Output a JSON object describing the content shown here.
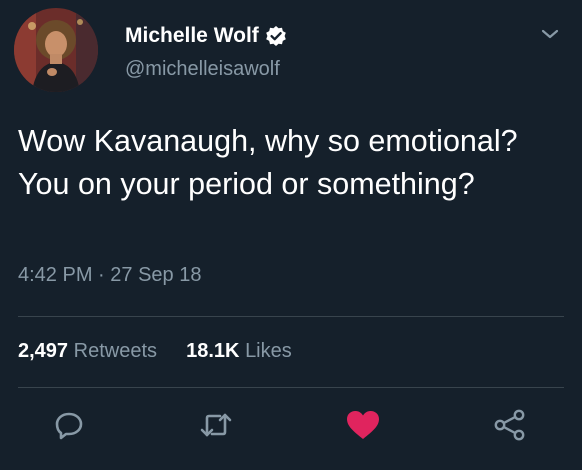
{
  "tweet": {
    "display_name": "Michelle Wolf",
    "handle": "@michelleisawolf",
    "text": "Wow Kavanaugh, why so emotional? You on your period or something?",
    "time": "4:42 PM",
    "separator": "·",
    "date": "27 Sep 18",
    "retweets_count": "2,497",
    "retweets_label": "Retweets",
    "likes_count": "18.1K",
    "likes_label": "Likes",
    "liked": true
  },
  "icons": {
    "verified": "verified-badge-icon",
    "menu": "chevron-down-icon",
    "reply": "reply-icon",
    "retweet": "retweet-icon",
    "like": "heart-icon",
    "share": "share-icon"
  },
  "colors": {
    "background": "#15202b",
    "text_primary": "#ffffff",
    "text_secondary": "#8899a6",
    "divider": "#38444d",
    "like_active": "#e0245e"
  }
}
